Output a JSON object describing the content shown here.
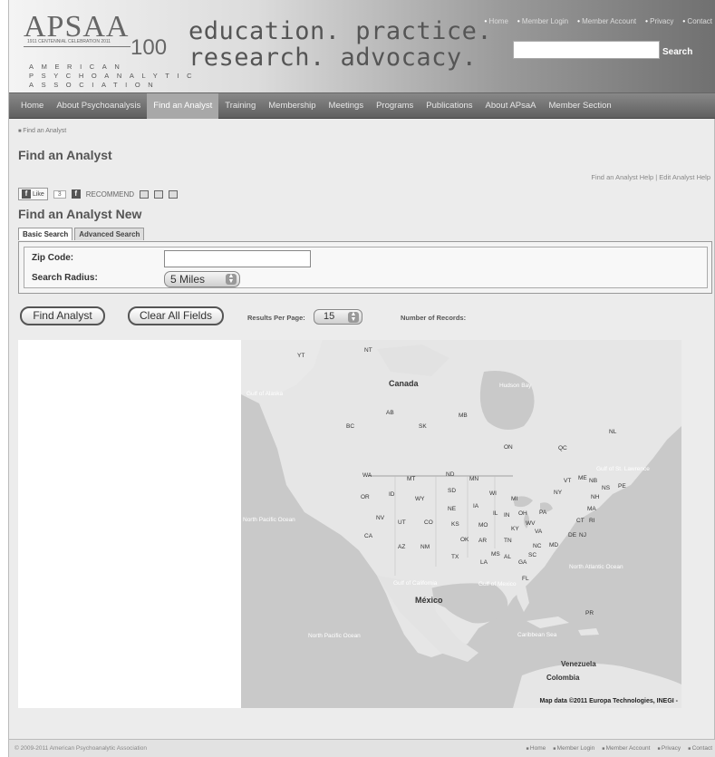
{
  "header": {
    "logo_mark": "APSAA",
    "logo_number": "100",
    "logo_small": "1911 CENTENNIAL CELEBRATION 2011",
    "logo_words": [
      "AMERICAN",
      "PSYCHOANALYTIC",
      "ASSOCIATION"
    ],
    "tagline_line1": "education. practice.",
    "tagline_line2": "research. advocacy.",
    "util_links": [
      "Home",
      "Member Login",
      "Member Account",
      "Privacy",
      "Contact"
    ],
    "search_placeholder": "",
    "search_button": "Search"
  },
  "nav": {
    "items": [
      "Home",
      "About Psychoanalysis",
      "Find an Analyst",
      "Training",
      "Membership",
      "Meetings",
      "Programs",
      "Publications",
      "About APsaA",
      "Member Section"
    ],
    "active_index": 2
  },
  "content": {
    "breadcrumb": "Find an Analyst",
    "title": "Find an Analyst",
    "help_links": "Find an Analyst Help | Edit Analyst Help",
    "social": {
      "like_label": "Like",
      "like_count": "3",
      "recommend_label": "RECOMMEND"
    },
    "subtitle": "Find an Analyst New",
    "tabs": [
      "Basic Search",
      "Advanced Search"
    ],
    "active_tab": 0,
    "form": {
      "zip_label": "Zip Code:",
      "zip_value": "",
      "radius_label": "Search Radius:",
      "radius_value": "5 Miles"
    },
    "buttons": {
      "find": "Find Analyst",
      "clear": "Clear All Fields"
    },
    "results_per_page_label": "Results Per Page:",
    "results_per_page_value": "15",
    "number_of_records_label": "Number of Records:"
  },
  "map": {
    "labels": {
      "canada": "Canada",
      "mexico": "México",
      "venezuela": "Venezuela",
      "colombia": "Colombia",
      "north_pacific_1": "North Pacific Ocean",
      "north_pacific_2": "North Pacific Ocean",
      "north_atlantic": "North Atlantic Ocean",
      "gulf_alaska": "Gulf of Alaska",
      "gulf_mexico": "Gulf of Mexico",
      "gulf_california": "Gulf of California",
      "hudson_bay": "Hudson Bay",
      "caribbean": "Caribbean Sea",
      "gulf_st_lawrence": "Gulf of St. Lawrence"
    },
    "regions": [
      "YT",
      "NT",
      "BC",
      "AB",
      "SK",
      "MB",
      "ON",
      "QC",
      "NL",
      "NB",
      "NS",
      "PE",
      "WA",
      "OR",
      "ID",
      "MT",
      "WY",
      "NV",
      "UT",
      "CO",
      "CA",
      "AZ",
      "NM",
      "ND",
      "SD",
      "NE",
      "KS",
      "OK",
      "TX",
      "MN",
      "IA",
      "MO",
      "AR",
      "LA",
      "WI",
      "IL",
      "MS",
      "AL",
      "GA",
      "FL",
      "TN",
      "KY",
      "IN",
      "OH",
      "MI",
      "PA",
      "WV",
      "VA",
      "NC",
      "SC",
      "NY",
      "VT",
      "NH",
      "ME",
      "MA",
      "CT",
      "RI",
      "NJ",
      "DE",
      "MD",
      "PR"
    ],
    "credit": "Map data ©2011 Europa Technologies, INEGI -"
  },
  "footer": {
    "copyright": "© 2009-2011 American Psychoanalytic Association",
    "links": [
      "Home",
      "Member Login",
      "Member Account",
      "Privacy",
      "Contact"
    ]
  }
}
